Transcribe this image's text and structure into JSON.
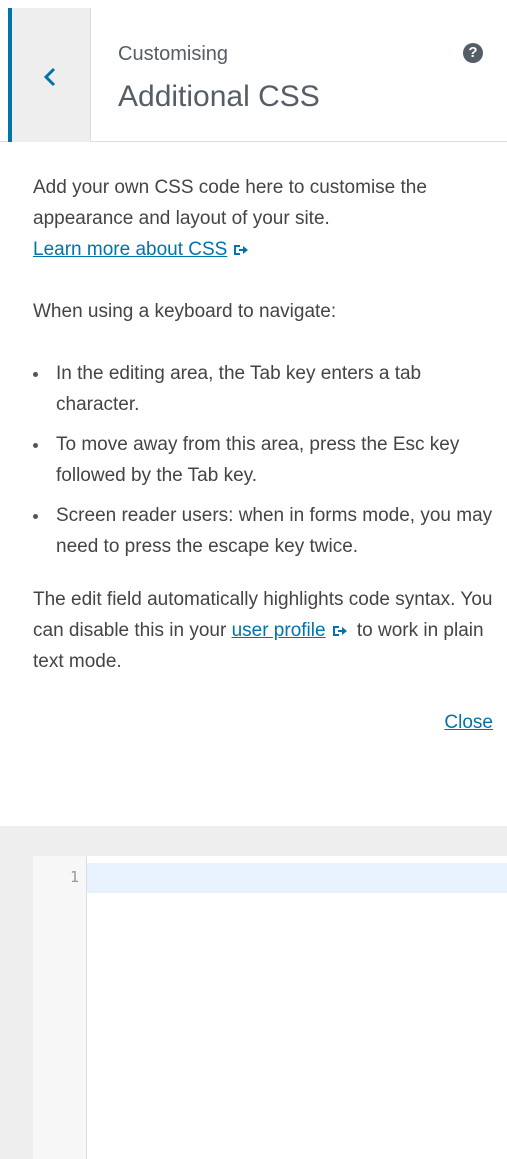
{
  "header": {
    "back_icon": "chevron-left-icon",
    "breadcrumb": "Customising",
    "title": "Additional CSS",
    "help_icon": "help-icon",
    "help_glyph": "?"
  },
  "description": {
    "intro": "Add your own CSS code here to customise the appearance and layout of your site.",
    "learn_more_link": "Learn more about CSS",
    "keyboard_heading": "When using a keyboard to navigate:",
    "tips": [
      "In the editing area, the Tab key enters a tab character.",
      "To move away from this area, press the Esc key followed by the Tab key.",
      "Screen reader users: when in forms mode, you may need to press the escape key twice."
    ],
    "syntax_before": "The edit field automatically highlights code syntax. You can disable this in your",
    "user_profile_link": "user profile",
    "syntax_after": "to work in plain text mode.",
    "close_link": "Close",
    "external_link_icon": "external-link-icon"
  },
  "editor": {
    "line_numbers": [
      "1"
    ],
    "content": ""
  },
  "colors": {
    "accent": "#0073aa",
    "active_line": "#e8f2fe"
  }
}
